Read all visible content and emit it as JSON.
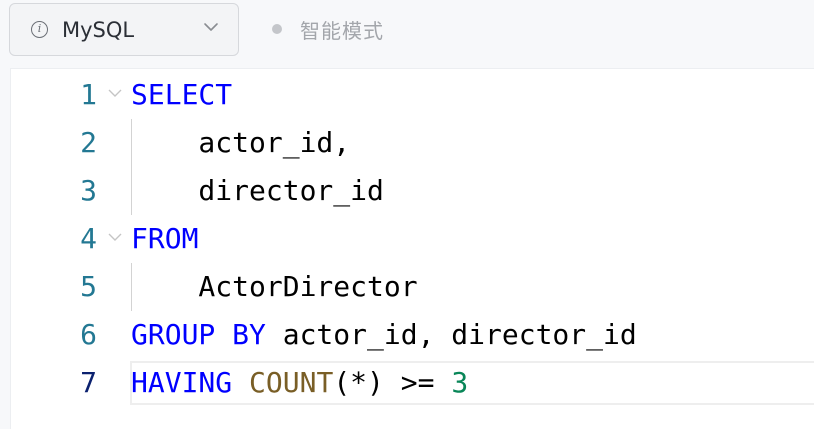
{
  "toolbar": {
    "language_label": "MySQL",
    "mode_label": "智能模式",
    "info_icon_glyph": "i"
  },
  "editor": {
    "lines": [
      {
        "number": "1",
        "tokens": [
          {
            "text": "SELECT",
            "kind": "kw"
          }
        ]
      },
      {
        "number": "2",
        "tokens": [
          {
            "text": "    actor_id,",
            "kind": "txt"
          }
        ]
      },
      {
        "number": "3",
        "tokens": [
          {
            "text": "    director_id",
            "kind": "txt"
          }
        ]
      },
      {
        "number": "4",
        "tokens": [
          {
            "text": "FROM",
            "kind": "kw"
          }
        ]
      },
      {
        "number": "5",
        "tokens": [
          {
            "text": "    ActorDirector",
            "kind": "txt"
          }
        ]
      },
      {
        "number": "6",
        "tokens": [
          {
            "text": "GROUP BY",
            "kind": "kw"
          },
          {
            "text": " actor_id, director_id",
            "kind": "txt"
          }
        ]
      },
      {
        "number": "7",
        "tokens": [
          {
            "text": "HAVING",
            "kind": "kw"
          },
          {
            "text": " ",
            "kind": "txt"
          },
          {
            "text": "COUNT",
            "kind": "fn"
          },
          {
            "text": "(*) >= ",
            "kind": "txt"
          },
          {
            "text": "3",
            "kind": "num"
          }
        ]
      }
    ],
    "active_line": 7,
    "fold_lines": [
      1,
      4
    ]
  },
  "colors": {
    "keyword": "#0000ff",
    "function": "#795e26",
    "number": "#098658",
    "line_number": "#237893",
    "active_line_number": "#0b216f"
  },
  "icons": {
    "info": "info-circle-icon",
    "chevron": "chevron-down-icon",
    "fold": "fold-chevron-icon"
  }
}
